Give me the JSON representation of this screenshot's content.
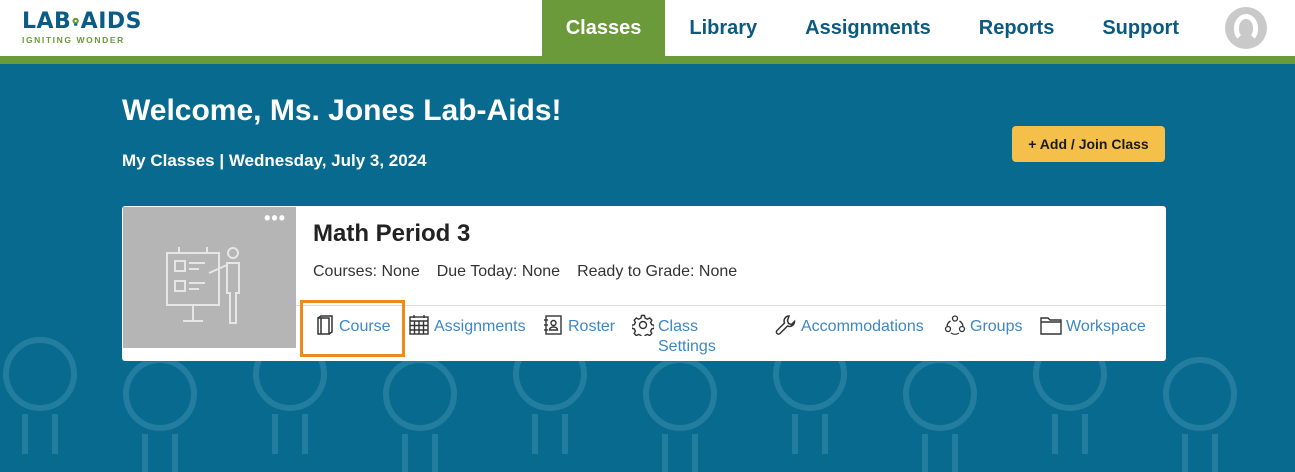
{
  "brand": {
    "name": "LAB AIDS",
    "left": "LAB",
    "right": "AIDS",
    "tagline": "IGNITING WONDER"
  },
  "nav": {
    "items": [
      {
        "label": "Classes",
        "active": true
      },
      {
        "label": "Library",
        "active": false
      },
      {
        "label": "Assignments",
        "active": false
      },
      {
        "label": "Reports",
        "active": false
      },
      {
        "label": "Support",
        "active": false
      }
    ],
    "avatar_icon": "user-avatar-icon"
  },
  "page": {
    "welcome": "Welcome, Ms. Jones Lab-Aids!",
    "subtitle": "My Classes | Wednesday, July 3, 2024",
    "add_button": "+ Add / Join Class"
  },
  "card": {
    "title": "Math Period 3",
    "menu": "•••",
    "meta": {
      "courses": "Courses: None",
      "due_today": "Due Today: None",
      "ready": "Ready to Grade: None"
    },
    "actions": [
      {
        "label": "Course",
        "icon": "book-icon"
      },
      {
        "label": "Assignments",
        "icon": "calendar-icon"
      },
      {
        "label": "Roster",
        "icon": "roster-icon"
      },
      {
        "label": "Class",
        "label2": "Settings",
        "icon": "gear-icon"
      },
      {
        "label": "Accommodations",
        "icon": "wrench-icon"
      },
      {
        "label": "Groups",
        "icon": "groups-icon"
      },
      {
        "label": "Workspace",
        "icon": "folder-icon"
      }
    ]
  },
  "colors": {
    "teal": "#076a8e",
    "green": "#6a9a3a",
    "navy_text": "#0d5a80",
    "link_blue": "#3c87c6",
    "button_yellow": "#f5c04a",
    "highlight_orange": "#ec8a1c"
  }
}
